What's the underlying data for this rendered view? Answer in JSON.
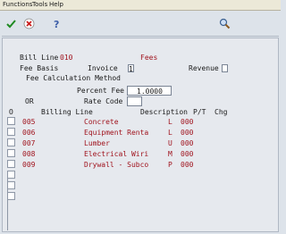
{
  "menu": [
    "Functions",
    "Tools",
    "Help"
  ],
  "toolbar": {
    "ok_icon": "checkmark-icon",
    "cancel_icon": "x-icon",
    "help_icon": "question-mark-icon",
    "search_icon": "magnifier-icon"
  },
  "form": {
    "bill_line_label": "Bill Line",
    "bill_line_value": "010",
    "bill_line_desc": "Fees",
    "fee_basis_label": "Fee Basis",
    "invoice_label": "Invoice",
    "invoice_value": "1",
    "revenue_label": "Revenue",
    "revenue_value": "",
    "fee_calc_label": "Fee Calculation Method",
    "percent_fee_label": "Percent Fee",
    "percent_fee_value": "1.0000",
    "or_label": "OR",
    "rate_code_label": "Rate Code",
    "rate_code_value": ""
  },
  "grid": {
    "headers": {
      "o": "O",
      "billing_line": "Billing Line",
      "description": "Description",
      "pt": "P/T",
      "chg": "Chg"
    },
    "rows": [
      {
        "line": "005",
        "description": "Concrete",
        "pt": "L",
        "chg": "000"
      },
      {
        "line": "006",
        "description": "Equipment Renta",
        "pt": "L",
        "chg": "000"
      },
      {
        "line": "007",
        "description": "Lumber",
        "pt": "U",
        "chg": "000"
      },
      {
        "line": "008",
        "description": "Electrical Wiri",
        "pt": "M",
        "chg": "000"
      },
      {
        "line": "009",
        "description": "Drywall - Subco",
        "pt": "P",
        "chg": "000"
      }
    ]
  },
  "colors": {
    "accent_red": "#a0141e",
    "background": "#dde3ea"
  }
}
